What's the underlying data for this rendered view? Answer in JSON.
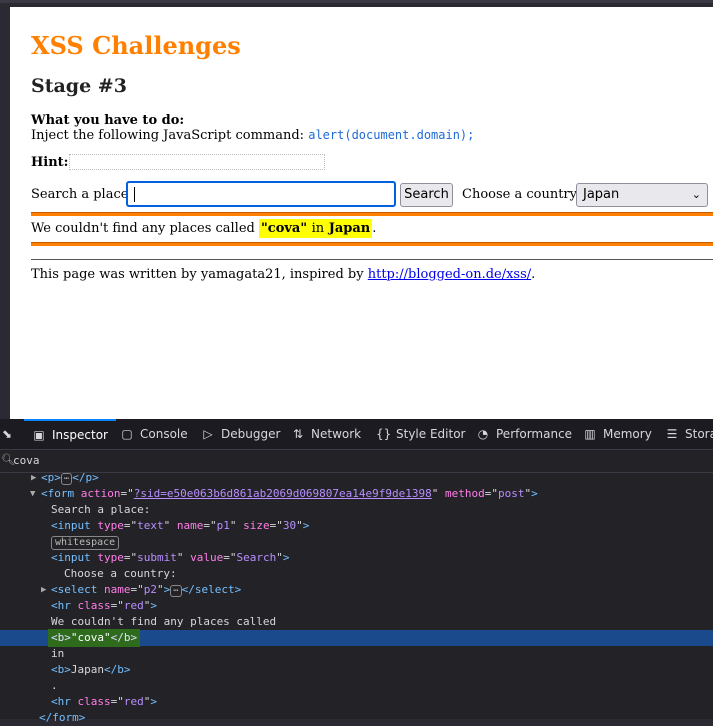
{
  "page": {
    "title": "XSS Challenges",
    "stage": "Stage #3",
    "todo_label": "What you have to do:",
    "inject_text": "Inject the following JavaScript command:",
    "inject_code": "alert(document.domain);",
    "hint_label": "Hint:",
    "search_label": "Search a place:",
    "search_value": "",
    "search_button": "Search",
    "country_label": "Choose a country:",
    "country_selected": "Japan",
    "result_prefix": "We couldn't find any places called",
    "result_query": "\"cova\"",
    "result_in": "in",
    "result_country": "Japan",
    "result_suffix": ".",
    "footer_prefix": "This page was written by yamagata21, inspired by",
    "footer_link": "http://blogged-on.de/xss/",
    "footer_suffix": "."
  },
  "devtools": {
    "tabs": [
      {
        "label": "Inspector",
        "icon": "inspector-icon"
      },
      {
        "label": "Console",
        "icon": "console-icon"
      },
      {
        "label": "Debugger",
        "icon": "debugger-icon"
      },
      {
        "label": "Network",
        "icon": "network-icon"
      },
      {
        "label": "Style Editor",
        "icon": "style-editor-icon"
      },
      {
        "label": "Performance",
        "icon": "performance-icon"
      },
      {
        "label": "Memory",
        "icon": "memory-icon"
      },
      {
        "label": "Stora",
        "icon": "storage-icon"
      }
    ],
    "search_query": "cova",
    "markup": {
      "p_open": "<p>",
      "p_close": "</p>",
      "ellipsis": "⋯",
      "form_tag": "form",
      "form_action_attr": "action",
      "form_action_val": "?sid=e50e063b6d861ab2069d069807ea14e9f9de1398",
      "form_method_attr": "method",
      "form_method_val": "post",
      "text1": "Search a place:",
      "input1_tag": "input",
      "input1_attrs": [
        [
          "type",
          "text"
        ],
        [
          "name",
          "p1"
        ],
        [
          "size",
          "30"
        ]
      ],
      "whitespace_badge": "whitespace",
      "input2_attrs": [
        [
          "type",
          "submit"
        ],
        [
          "value",
          "Search"
        ]
      ],
      "text2": "Choose a country:",
      "select_tag": "select",
      "select_attr": "name",
      "select_val": "p2",
      "hr_tag": "hr",
      "hr_attr": "class",
      "hr_val": "red",
      "text3": "We couldn't find any places called",
      "b_open": "<b>",
      "b_close": "</b>",
      "b_text": "\"cova\"",
      "text4": "in",
      "b2_text": "Japan",
      "text5": ".",
      "form_close": "</form>"
    }
  }
}
